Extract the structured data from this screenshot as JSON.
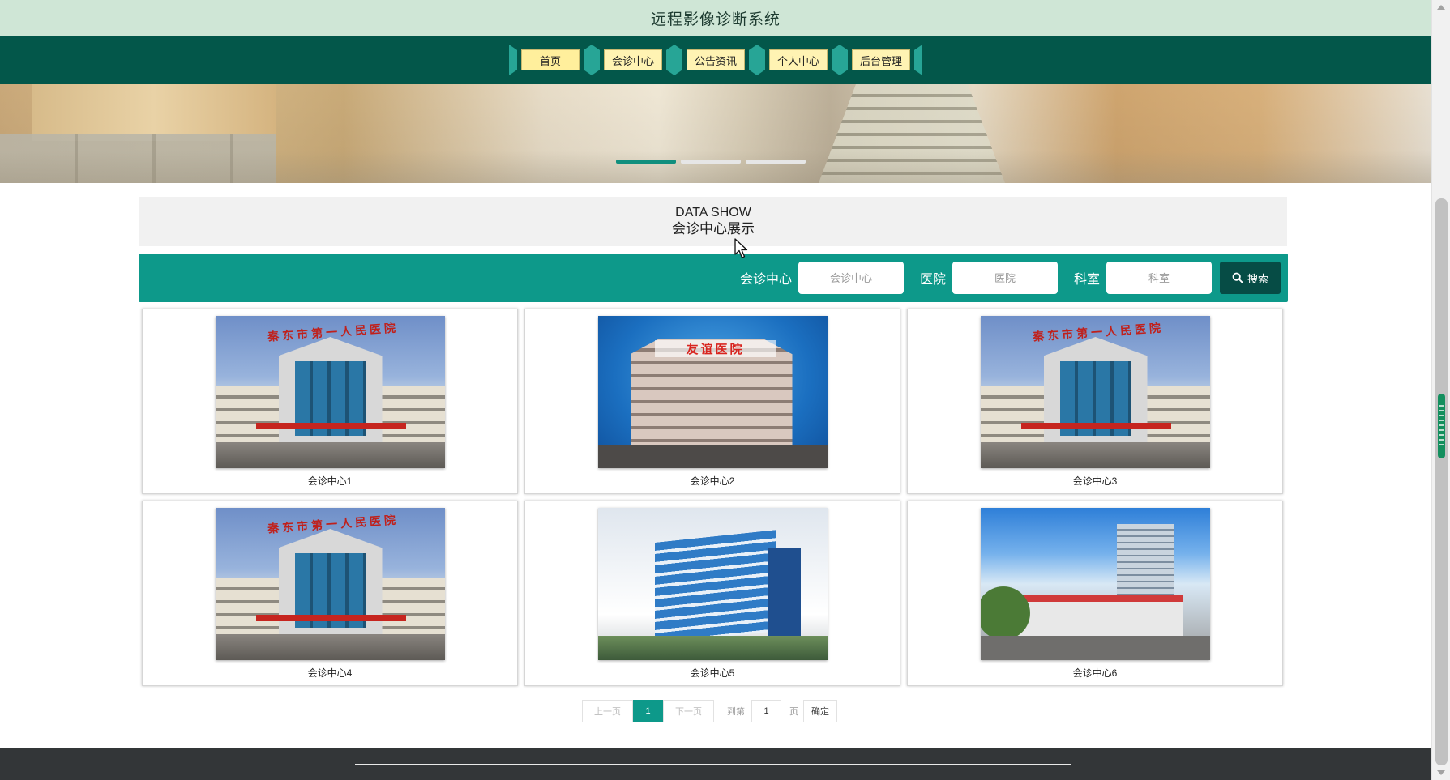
{
  "site": {
    "title": "远程影像诊断系统"
  },
  "nav": {
    "items": [
      {
        "label": "首页"
      },
      {
        "label": "会诊中心"
      },
      {
        "label": "公告资讯"
      },
      {
        "label": "个人中心"
      },
      {
        "label": "后台管理"
      }
    ]
  },
  "banner": {
    "active_slide": 1,
    "slide_count": 3
  },
  "section": {
    "title_en": "DATA SHOW",
    "title_cn": "会诊中心展示"
  },
  "search": {
    "fields": [
      {
        "label": "会诊中心",
        "placeholder": "会诊中心"
      },
      {
        "label": "医院",
        "placeholder": "医院"
      },
      {
        "label": "科室",
        "placeholder": "科室"
      }
    ],
    "button_label": "搜索"
  },
  "cards": [
    {
      "name": "会诊中心1",
      "sign": "秦东市第一人民医院",
      "style": "type-a"
    },
    {
      "name": "会诊中心2",
      "sign": "友谊医院",
      "style": "type-b"
    },
    {
      "name": "会诊中心3",
      "sign": "秦东市第一人民医院",
      "style": "type-a"
    },
    {
      "name": "会诊中心4",
      "sign": "秦东市第一人民医院",
      "style": "type-a"
    },
    {
      "name": "会诊中心5",
      "sign": "",
      "style": "type-c"
    },
    {
      "name": "会诊中心6",
      "sign": "",
      "style": "type-d"
    }
  ],
  "pagination": {
    "prev_label": "上一页",
    "current_page": "1",
    "next_label": "下一页",
    "goto_prefix": "到第",
    "goto_value": "1",
    "goto_suffix": "页",
    "confirm_label": "确定"
  },
  "colors": {
    "header_bg": "#cfe6d6",
    "nav_bg": "#03574a",
    "accent": "#0d998a",
    "footer_bg": "#333638"
  }
}
